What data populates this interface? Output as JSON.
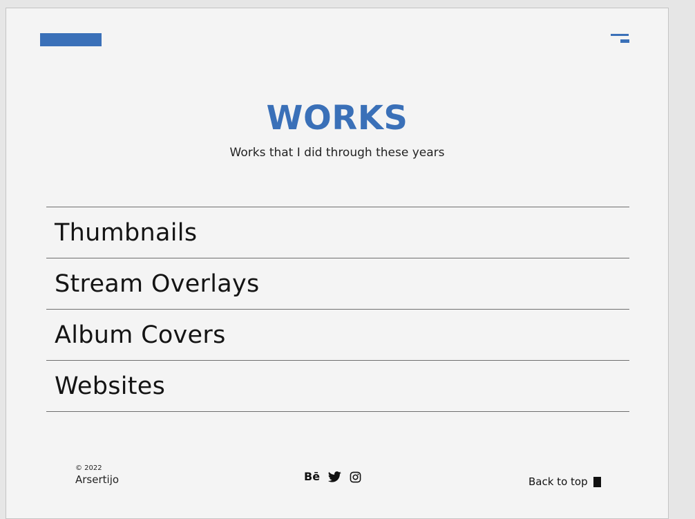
{
  "header": {
    "logo_icon": "logo-mark",
    "menu_icon": "hamburger-menu-icon",
    "accent_color": "#3a70b8"
  },
  "main": {
    "title": "WORKS",
    "subtitle": "Works that I did through these years",
    "categories": [
      {
        "label": "Thumbnails"
      },
      {
        "label": "Stream Overlays"
      },
      {
        "label": "Album Covers"
      },
      {
        "label": "Websites"
      }
    ]
  },
  "footer": {
    "copyright": "© 2022",
    "name": "Arsertijo",
    "social": {
      "behance": "Bē",
      "twitter_icon": "twitter-icon",
      "instagram_icon": "instagram-icon"
    },
    "back_to_top": "Back to top"
  }
}
